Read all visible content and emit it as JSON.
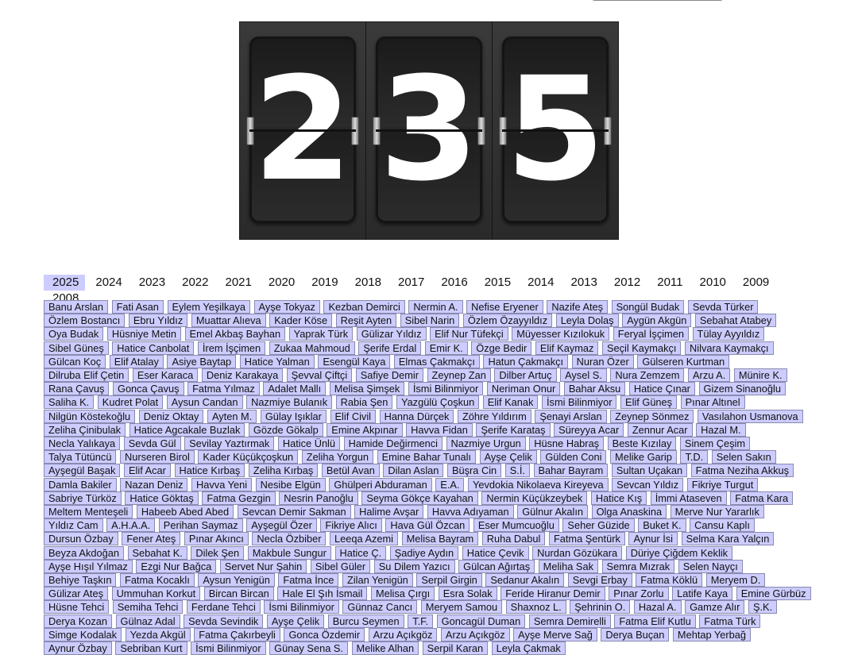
{
  "counter": {
    "digits": [
      "2",
      "3",
      "5"
    ]
  },
  "years": [
    "2025",
    "2024",
    "2023",
    "2022",
    "2021",
    "2020",
    "2019",
    "2018",
    "2017",
    "2016",
    "2015",
    "2014",
    "2013",
    "2012",
    "2011",
    "2010",
    "2009",
    "2008"
  ],
  "selected_year": "2025",
  "names": [
    "Banu Arslan",
    "Fati Asan",
    "Eylem Yeşilkaya",
    "Ayşe Tokyaz",
    "Kezban Demirci",
    "Nermin A.",
    "Nefise Eryener",
    "Nazife Ateş",
    "Songül Budak",
    "Sevda Türker",
    "Özlem Bostancı",
    "Ebru Yıldız",
    "Muattar Alıeva",
    "Kader Köse",
    "Reşit Ayten",
    "Sibel Narin",
    "Özlem Özayyıldız",
    "Leyla Dolaş",
    "Aygün Akgün",
    "Sebahat Atabey",
    "Oya Budak",
    "Hüsniye Metin",
    "Emel Akbaş Bayhan",
    "Yaprak Türk",
    "Gülizar Yıldız",
    "Elif Nur Tüfekçi",
    "Müyesser Kızılokuk",
    "Feryal İşçimen",
    "Tülay Ayyıldız",
    "Sibel Güneş",
    "Hatice Canbolat",
    "İrem İşçimen",
    "Zukaa Mahmoud",
    "Şerife Erdal",
    "Emir K.",
    "Özge Bedir",
    "Elif Kaymaz",
    "Seçil Kaymakçı",
    "Nilvara Kaymakçı",
    "Gülcan Koç",
    "Elif Atalay",
    "Asiye Baytap",
    "Hatice Yalman",
    "Esengül Kaya",
    "Elmas Çakmakçı",
    "Hatun Çakmakçı",
    "Nuran Özer",
    "Gülseren Kurtman",
    "Dilruba Elif Çetin",
    "Eser Karaca",
    "Deniz Karakaya",
    "Şevval Çiftçi",
    "Safiye Demir",
    "Zeynep Zan",
    "Dilber Artuç",
    "Aysel S.",
    "Nura Zemzem",
    "Arzu A.",
    "Münire K.",
    "Rana Çavuş",
    "Gonca Çavuş",
    "Fatma Yılmaz",
    "Adalet Mallı",
    "Melisa Şimşek",
    "İsmi Bilinmiyor",
    "Neriman Onur",
    "Bahar Aksu",
    "Hatice Çınar",
    "Gizem Sinanoğlu",
    "Saliha K.",
    "Kudret Polat",
    "Aysun Candan",
    "Nazmiye Bulanık",
    "Rabia Şen",
    "Yazgülü Çoşkun",
    "Elif Kanak",
    "İsmi Bilinmiyor",
    "Elif Güneş",
    "Pınar Altınel",
    "Nilgün Köstekoğlu",
    "Deniz Oktay",
    "Ayten M.",
    "Gülay Işıklar",
    "Elif Civil",
    "Hanna Dürçek",
    "Zöhre Yıldırım",
    "Şenayi Arslan",
    "Zeynep Sönmez",
    "Vasılahon Usmanova",
    "Zeliha Çinibulak",
    "Hatice Agcakale Buzlak",
    "Gözde Gökalp",
    "Emine Akpınar",
    "Havva Fidan",
    "Şerife Karataş",
    "Süreyya Acar",
    "Zennur Acar",
    "Hazal M.",
    "Necla Yalıkaya",
    "Sevda Gül",
    "Sevilay Yaztırmak",
    "Hatice Ünlü",
    "Hamide Değirmenci",
    "Nazmiye Urgun",
    "Hüsne Habraş",
    "Beste Kızılay",
    "Sinem Çeşim",
    "Talya Tütüncü",
    "Nurseren Birol",
    "Kader Küçükçoşkun",
    "Zeliha Yorgun",
    "Emine Bahar Tunalı",
    "Ayşe Çelik",
    "Gülden Coni",
    "Melike Garip",
    "T.D.",
    "Selen Sakın",
    "Ayşegül Başak",
    "Elif Acar",
    "Hatice Kırbaş",
    "Zeliha Kırbaş",
    "Betül Avan",
    "Dilan Aslan",
    "Büşra Cin",
    "S.İ.",
    "Bahar Bayram",
    "Sultan Uçakan",
    "Fatma Neziha Akkuş",
    "Damla Bakiler",
    "Nazan Deniz",
    "Havva Yeni",
    "Nesibe Elgün",
    "Ghülperi Abduraman",
    "E.A.",
    "Yevdokia Nikolaeva Kireyeva",
    "Sevcan Yıldız",
    "Fikriye Turgut",
    "Sabriye Türköz",
    "Hatice Göktaş",
    "Fatma Gezgin",
    "Nesrin Panoğlu",
    "Seyma Gökçe Kayahan",
    "Nermin Küçükzeybek",
    "Hatice Kış",
    "İmmi Ataseven",
    "Fatma Kara",
    "Meltem Menteşeli",
    "Habeeb Abed Abed",
    "Sevcan Demir Sakman",
    "Halime Avşar",
    "Havva Adıyaman",
    "Gülnur Akalın",
    "Olga Anaskina",
    "Merve Nur Yararlık",
    "Yıldız Cam",
    "A.H.A.A.",
    "Perihan Saymaz",
    "Ayşegül Özer",
    "Fikriye Alıcı",
    "Hava Gül Özcan",
    "Eser Mumcuoğlu",
    "Seher Güzide",
    "Buket K.",
    "Cansu Kaplı",
    "Dursun Özbay",
    "Fener Ateş",
    "Pınar Akıncı",
    "Necla Özbiber",
    "Leeqa Azemi",
    "Melisa Bayram",
    "Ruha Dabul",
    "Fatma Şentürk",
    "Aynur İsi",
    "Selma Kara Yalçın",
    "Beyza Akdoğan",
    "Sebahat K.",
    "Dilek Şen",
    "Makbule Sungur",
    "Hatice Ç.",
    "Şadiye Aydın",
    "Hatice Çevik",
    "Nurdan Gözükara",
    "Düriye Çiğdem Keklik",
    "Ayşe Hışıl Yılmaz",
    "Ezgi Nur Bağca",
    "Servet Nur Şahin",
    "Sibel Güler",
    "Su Dilem Yazıcı",
    "Gülcan Ağırtaş",
    "Meliha Sak",
    "Semra Mızrak",
    "Selen Nayçı",
    "Behiye Taşkın",
    "Fatma Kocaklı",
    "Aysun Yenigün",
    "Fatma İnce",
    "Zilan Yenigün",
    "Serpil Girgin",
    "Sedanur Akalın",
    "Sevgi Erbay",
    "Fatma Köklü",
    "Meryem D.",
    "Gülizar Ateş",
    "Ummuhan Korkut",
    "Bircan Bircan",
    "Hale El Şıh İsmail",
    "Melisa Çırgı",
    "Esra Solak",
    "Feride Hiranur Demir",
    "Pınar Zorlu",
    "Latife Kaya",
    "Emine Gürbüz",
    "Hüsne Tehci",
    "Semiha Tehci",
    "Ferdane Tehci",
    "İsmi Bilinmiyor",
    "Günnaz Cancı",
    "Meryem Samou",
    "Shaxnoz L.",
    "Şehrinin O.",
    "Hazal A.",
    "Gamze Alır",
    "Ş.K.",
    "Derya Kozan",
    "Gülnaz Adal",
    "Sevda Sevindik",
    "Ayşe Çelik",
    "Burcu Seymen",
    "T.F.",
    "Goncagül Duman",
    "Semra Demirelli",
    "Fatma Elif Kutlu",
    "Fatma Türk",
    "Simge Kodalak",
    "Yezda Akgül",
    "Fatma Çakırbeyli",
    "Gonca Özdemir",
    "Arzu Açıkgöz",
    "Arzu Açıkgöz",
    "Ayşe Merve Sağ",
    "Derya Buçan",
    "Mehtap Yerbağ",
    "Aynur Özbay",
    "Sebriban Kurt",
    "İsmi Bilinmiyor",
    "Günay Sena S.",
    "Melike Alhan",
    "Serpil Karan",
    "Leyla Çakmak"
  ]
}
